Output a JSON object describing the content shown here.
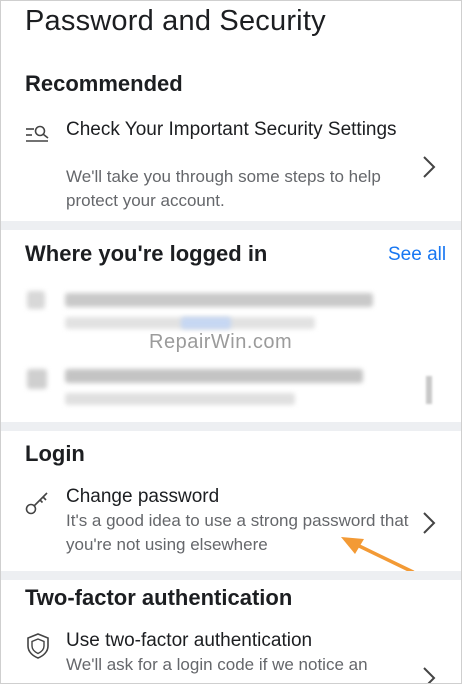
{
  "header": {
    "title": "Password and Security"
  },
  "recommended": {
    "heading": "Recommended",
    "item": {
      "title": "Check Your Important Security Settings",
      "subtitle": "We'll take you through some steps to help protect your account.",
      "icon": "search-list-icon"
    }
  },
  "logged_in": {
    "heading": "Where you're logged in",
    "see_all_label": "See all"
  },
  "watermark": {
    "text": "RepairWin.com"
  },
  "login": {
    "heading": "Login",
    "item": {
      "title": "Change password",
      "subtitle": "It's a good idea to use a strong password that you're not using elsewhere",
      "icon": "key-icon"
    }
  },
  "two_factor": {
    "heading": "Two-factor authentication",
    "item": {
      "title": "Use two-factor authentication",
      "subtitle": "We'll ask for a login code if we notice an",
      "icon": "shield-icon"
    }
  },
  "colors": {
    "link": "#1877f2",
    "annotation_arrow": "#f39a35",
    "divider": "#edeff2"
  }
}
